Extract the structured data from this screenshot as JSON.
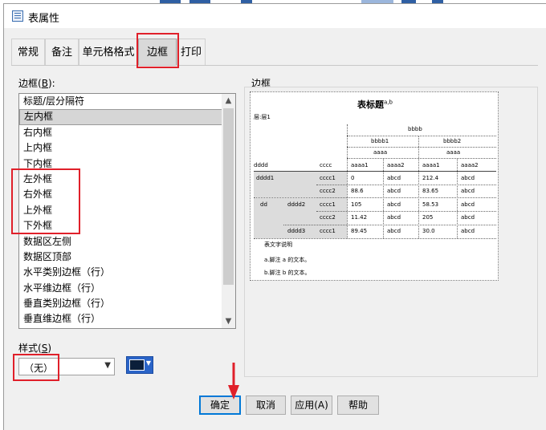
{
  "window": {
    "title": "表属性"
  },
  "tabs": [
    {
      "label": "常规",
      "active": false
    },
    {
      "label": "备注",
      "active": false
    },
    {
      "label": "单元格格式",
      "active": false
    },
    {
      "label": "边框",
      "active": true
    },
    {
      "label": "打印",
      "active": false
    }
  ],
  "border_list": {
    "label": "边框",
    "hotkey": "B",
    "selected": "左内框",
    "items": [
      "标题/层分隔符",
      "左内框",
      "右内框",
      "上内框",
      "下内框",
      "左外框",
      "右外框",
      "上外框",
      "下外框",
      "数据区左侧",
      "数据区顶部",
      "水平类别边框（行）",
      "水平维边框（行）",
      "垂直类别边框（行）",
      "垂直维边框（行）"
    ]
  },
  "style": {
    "label": "样式",
    "hotkey": "S",
    "value": "（无）",
    "color": "#0b1f3a"
  },
  "preview": {
    "group_label": "边框",
    "title": "表标题",
    "title_sup": "a,b",
    "corner": "层:层1",
    "header_bbbb": "bbbb",
    "header_bbbb1": "bbbb1",
    "header_bbbb2": "bbbb2",
    "header_aaaa_1": "aaaa",
    "header_aaaa_2": "aaaa",
    "col_dddd": "dddd",
    "col_cccc": "cccc",
    "col_aaaa1_1": "aaaa1",
    "col_aaaa2_1": "aaaa2",
    "col_aaaa1_2": "aaaa1",
    "col_aaaa2_2": "aaaa2",
    "rows": [
      {
        "g1": "dddd1",
        "g2": "",
        "c": "cccc1",
        "v1": "0",
        "v2": "abcd",
        "v3": "212.4",
        "v4": "abcd"
      },
      {
        "g1": "",
        "g2": "",
        "c": "cccc2",
        "v1": "88.6",
        "v2": "abcd",
        "v3": "83.65",
        "v4": "abcd"
      },
      {
        "g1": "dd",
        "g2": "dddd2",
        "c": "cccc1",
        "v1": "105",
        "v2": "abcd",
        "v3": "58.53",
        "v4": "abcd"
      },
      {
        "g1": "",
        "g2": "",
        "c": "cccc2",
        "v1": "11.42",
        "v2": "abcd",
        "v3": "205",
        "v4": "abcd"
      },
      {
        "g1": "",
        "g2": "dddd3",
        "c": "cccc1",
        "v1": "89.45",
        "v2": "abcd",
        "v3": "30.0",
        "v4": "abcd"
      }
    ],
    "caption": "表文字说明",
    "footnote_a": "a.脚注 a 的文本。",
    "footnote_b": "b.脚注 b 的文本。"
  },
  "buttons": {
    "ok": "确定",
    "cancel": "取消",
    "apply": "应用(A)",
    "help": "帮助"
  },
  "colors": {
    "annotation": "#e0202a",
    "accent": "#0078d7"
  }
}
